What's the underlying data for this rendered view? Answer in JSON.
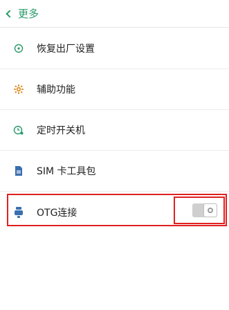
{
  "header": {
    "title": "更多"
  },
  "items": [
    {
      "label": "恢复出厂设置",
      "icon": "restore-icon"
    },
    {
      "label": "辅助功能",
      "icon": "accessibility-icon"
    },
    {
      "label": "定时开关机",
      "icon": "scheduled-power-icon"
    },
    {
      "label": "SIM 卡工具包",
      "icon": "sim-card-icon"
    },
    {
      "label": "OTG连接",
      "icon": "otg-icon"
    }
  ],
  "otg_toggle": {
    "state": "off"
  },
  "colors": {
    "accent": "#2a9a6a",
    "highlight": "#e02020",
    "toggle_off": "#cfcfcf"
  }
}
